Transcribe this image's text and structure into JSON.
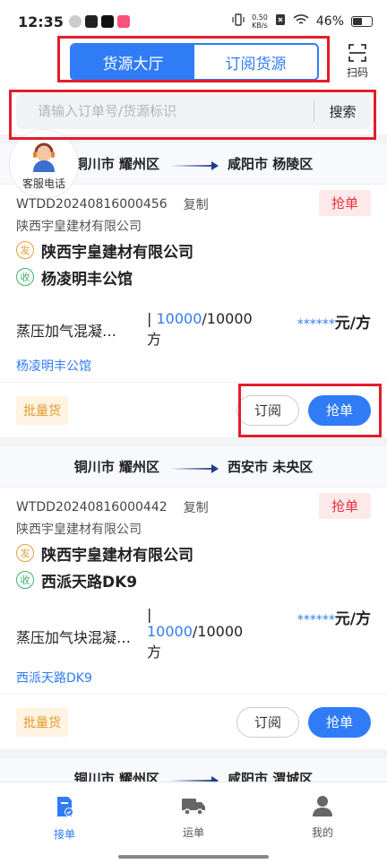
{
  "status_bar": {
    "time": "12:35",
    "net_speed_value": "0.50",
    "net_speed_unit": "KB/s",
    "battery": "46%"
  },
  "header": {
    "tabs": [
      {
        "label": "货源大厅",
        "active": true
      },
      {
        "label": "订阅货源",
        "active": false
      }
    ],
    "scan_label": "扫码"
  },
  "search": {
    "placeholder": "请输入订单号/货源标识",
    "button_label": "搜索"
  },
  "service": {
    "label": "客服电话"
  },
  "orders": [
    {
      "origin": "铜川市 耀州区",
      "destination": "咸阳市 杨陵区",
      "order_id": "WTDD20240816000456",
      "copy_label": "复制",
      "grab_tag": "抢单",
      "shipper_company": "陕西宇皇建材有限公司",
      "sender_badge": "发",
      "sender": "陕西宇皇建材有限公司",
      "receiver_badge": "收",
      "receiver": "杨凌明丰公馆",
      "cargo_name": "蒸压加气混凝…",
      "qty_prefix": "| ",
      "qty_remaining": "10000",
      "qty_total": "/10000",
      "qty_unit": "方",
      "price_masked": "******",
      "price_unit": "元/方",
      "dest_address": "杨凌明丰公馆",
      "batch_label": "批量货",
      "subscribe_label": "订阅",
      "grab_label": "抢单"
    },
    {
      "origin": "铜川市 耀州区",
      "destination": "西安市 未央区",
      "order_id": "WTDD20240816000442",
      "copy_label": "复制",
      "grab_tag": "抢单",
      "shipper_company": "陕西宇皇建材有限公司",
      "sender_badge": "发",
      "sender": "陕西宇皇建材有限公司",
      "receiver_badge": "收",
      "receiver": "西派天路DK9",
      "cargo_name": "蒸压加气块混凝…",
      "qty_prefix": "|",
      "qty_remaining": "10000",
      "qty_total": "/10000",
      "qty_unit": "方",
      "price_masked": "******",
      "price_unit": "元/方",
      "dest_address": "西派天路DK9",
      "batch_label": "批量货",
      "subscribe_label": "订阅",
      "grab_label": "抢单"
    },
    {
      "origin": "铜川市 耀州区",
      "destination": "咸阳市 渭城区"
    }
  ],
  "tabbar": [
    {
      "label": "接单",
      "icon": "order-icon",
      "active": true
    },
    {
      "label": "运单",
      "icon": "truck-icon",
      "active": false
    },
    {
      "label": "我的",
      "icon": "user-icon",
      "active": false
    }
  ],
  "colors": {
    "primary": "#2f7cf6",
    "highlight": "#e31d2b",
    "grab_tag_bg": "#fde8ea",
    "batch_bg": "#fff3e2"
  }
}
